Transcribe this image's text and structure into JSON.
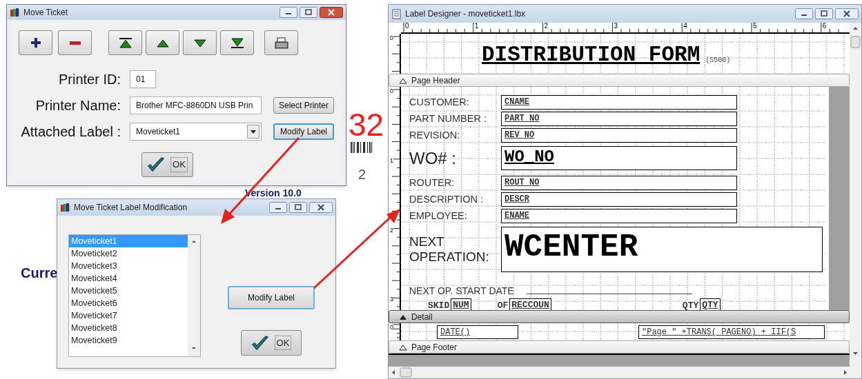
{
  "desktop": {
    "texts": [
      {
        "kind": "barcode_number",
        "text": "32"
      },
      {
        "kind": "digit",
        "text": "2"
      },
      {
        "kind": "version",
        "text": "Version 10.0"
      },
      {
        "kind": "heading",
        "text": "Curre"
      }
    ]
  },
  "move_ticket": {
    "title": "Move Ticket",
    "fields": [
      {
        "kind": "text",
        "label": "Printer ID:",
        "value": "01"
      },
      {
        "kind": "text",
        "label": "Printer Name:",
        "value": "Brother MFC-8860DN USB Prin",
        "button": {
          "label": "Select Printer",
          "focused": false
        }
      },
      {
        "kind": "dropdown",
        "label": "Attached Label :",
        "value": "Moveticket1",
        "button": {
          "label": "Modify Label",
          "focused": true
        }
      }
    ],
    "ok": "OK"
  },
  "modification": {
    "title": "Move Ticket Label Modification",
    "items": [
      {
        "text": "Moveticket1",
        "selected": true
      },
      {
        "text": "Moveticket2",
        "selected": false
      },
      {
        "text": "Moveticket3",
        "selected": false
      },
      {
        "text": "Moveticket4",
        "selected": false
      },
      {
        "text": "Moveticket5",
        "selected": false
      },
      {
        "text": "Moveticket6",
        "selected": false
      },
      {
        "text": "Moveticket7",
        "selected": false
      },
      {
        "text": "Moveticket8",
        "selected": false
      },
      {
        "text": "Moveticket9",
        "selected": false
      }
    ],
    "modify": "Modify Label",
    "ok": "OK"
  },
  "designer": {
    "title": "Label Designer - moveticket1.lbx",
    "ruler": [
      "0",
      "1",
      "2",
      "3",
      "4",
      "5",
      "6"
    ],
    "report_title": {
      "title": "DISTRIBUTION FORM",
      "note": "(S500)",
      "ruler": [
        "0"
      ]
    },
    "bands": [
      {
        "label": "Page Header",
        "selected": false
      },
      {
        "label": "Detail",
        "selected": true
      },
      {
        "label": "Page Footer",
        "selected": false
      }
    ],
    "page_header": {
      "ruler": [
        "0",
        "1",
        "2",
        "3"
      ],
      "rows": [
        {
          "kind": "field",
          "label": "CUSTOMER:",
          "field": "CNAME"
        },
        {
          "kind": "field",
          "label": "PART NUMBER :",
          "field": "PART_NO"
        },
        {
          "kind": "field",
          "label": "REVISION:",
          "field": "REV_NO"
        },
        {
          "kind": "large",
          "label": "WO# :",
          "field": "WO_NO"
        },
        {
          "kind": "field",
          "label": "ROUTER:",
          "field": "ROUT_NO"
        },
        {
          "kind": "field",
          "label": "DESCRIPTION :",
          "field": "DESCR"
        },
        {
          "kind": "field",
          "label": "EMPLOYEE:",
          "field": "ENAME"
        },
        {
          "kind": "operation",
          "label": "NEXT OPERATION:",
          "field": "WCENTER"
        },
        {
          "kind": "blank",
          "label": "NEXT OP. START DATE"
        }
      ],
      "skid": [
        "SKID",
        "NUM",
        "OF",
        "RECCOUN",
        "QTY",
        "QTY"
      ]
    },
    "detail": {
      "ruler": [
        "0"
      ],
      "fields": [
        "DATE()",
        "\"Page \" +TRANS(_PAGENO) + IIF(S"
      ]
    }
  }
}
